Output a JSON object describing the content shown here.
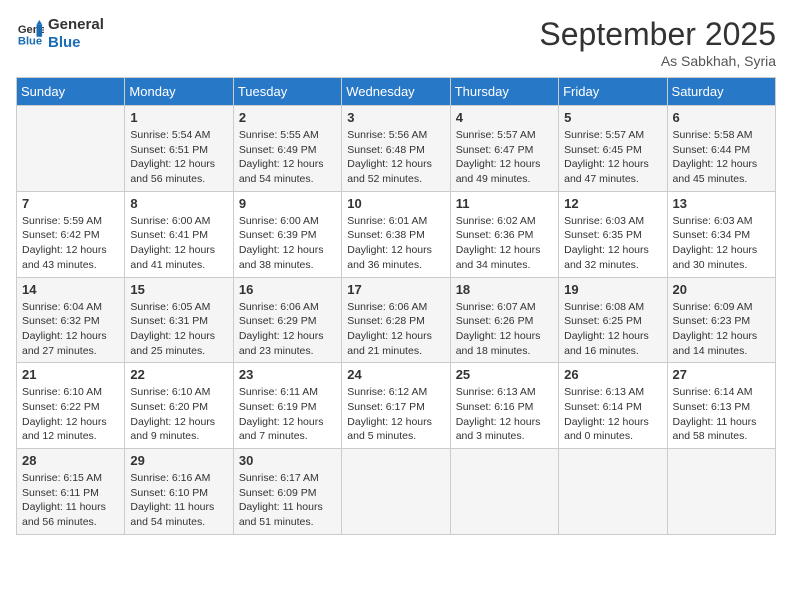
{
  "logo": {
    "line1": "General",
    "line2": "Blue"
  },
  "title": "September 2025",
  "location": "As Sabkhah, Syria",
  "days_header": [
    "Sunday",
    "Monday",
    "Tuesday",
    "Wednesday",
    "Thursday",
    "Friday",
    "Saturday"
  ],
  "weeks": [
    [
      {
        "day": "",
        "info": ""
      },
      {
        "day": "1",
        "info": "Sunrise: 5:54 AM\nSunset: 6:51 PM\nDaylight: 12 hours\nand 56 minutes."
      },
      {
        "day": "2",
        "info": "Sunrise: 5:55 AM\nSunset: 6:49 PM\nDaylight: 12 hours\nand 54 minutes."
      },
      {
        "day": "3",
        "info": "Sunrise: 5:56 AM\nSunset: 6:48 PM\nDaylight: 12 hours\nand 52 minutes."
      },
      {
        "day": "4",
        "info": "Sunrise: 5:57 AM\nSunset: 6:47 PM\nDaylight: 12 hours\nand 49 minutes."
      },
      {
        "day": "5",
        "info": "Sunrise: 5:57 AM\nSunset: 6:45 PM\nDaylight: 12 hours\nand 47 minutes."
      },
      {
        "day": "6",
        "info": "Sunrise: 5:58 AM\nSunset: 6:44 PM\nDaylight: 12 hours\nand 45 minutes."
      }
    ],
    [
      {
        "day": "7",
        "info": "Sunrise: 5:59 AM\nSunset: 6:42 PM\nDaylight: 12 hours\nand 43 minutes."
      },
      {
        "day": "8",
        "info": "Sunrise: 6:00 AM\nSunset: 6:41 PM\nDaylight: 12 hours\nand 41 minutes."
      },
      {
        "day": "9",
        "info": "Sunrise: 6:00 AM\nSunset: 6:39 PM\nDaylight: 12 hours\nand 38 minutes."
      },
      {
        "day": "10",
        "info": "Sunrise: 6:01 AM\nSunset: 6:38 PM\nDaylight: 12 hours\nand 36 minutes."
      },
      {
        "day": "11",
        "info": "Sunrise: 6:02 AM\nSunset: 6:36 PM\nDaylight: 12 hours\nand 34 minutes."
      },
      {
        "day": "12",
        "info": "Sunrise: 6:03 AM\nSunset: 6:35 PM\nDaylight: 12 hours\nand 32 minutes."
      },
      {
        "day": "13",
        "info": "Sunrise: 6:03 AM\nSunset: 6:34 PM\nDaylight: 12 hours\nand 30 minutes."
      }
    ],
    [
      {
        "day": "14",
        "info": "Sunrise: 6:04 AM\nSunset: 6:32 PM\nDaylight: 12 hours\nand 27 minutes."
      },
      {
        "day": "15",
        "info": "Sunrise: 6:05 AM\nSunset: 6:31 PM\nDaylight: 12 hours\nand 25 minutes."
      },
      {
        "day": "16",
        "info": "Sunrise: 6:06 AM\nSunset: 6:29 PM\nDaylight: 12 hours\nand 23 minutes."
      },
      {
        "day": "17",
        "info": "Sunrise: 6:06 AM\nSunset: 6:28 PM\nDaylight: 12 hours\nand 21 minutes."
      },
      {
        "day": "18",
        "info": "Sunrise: 6:07 AM\nSunset: 6:26 PM\nDaylight: 12 hours\nand 18 minutes."
      },
      {
        "day": "19",
        "info": "Sunrise: 6:08 AM\nSunset: 6:25 PM\nDaylight: 12 hours\nand 16 minutes."
      },
      {
        "day": "20",
        "info": "Sunrise: 6:09 AM\nSunset: 6:23 PM\nDaylight: 12 hours\nand 14 minutes."
      }
    ],
    [
      {
        "day": "21",
        "info": "Sunrise: 6:10 AM\nSunset: 6:22 PM\nDaylight: 12 hours\nand 12 minutes."
      },
      {
        "day": "22",
        "info": "Sunrise: 6:10 AM\nSunset: 6:20 PM\nDaylight: 12 hours\nand 9 minutes."
      },
      {
        "day": "23",
        "info": "Sunrise: 6:11 AM\nSunset: 6:19 PM\nDaylight: 12 hours\nand 7 minutes."
      },
      {
        "day": "24",
        "info": "Sunrise: 6:12 AM\nSunset: 6:17 PM\nDaylight: 12 hours\nand 5 minutes."
      },
      {
        "day": "25",
        "info": "Sunrise: 6:13 AM\nSunset: 6:16 PM\nDaylight: 12 hours\nand 3 minutes."
      },
      {
        "day": "26",
        "info": "Sunrise: 6:13 AM\nSunset: 6:14 PM\nDaylight: 12 hours\nand 0 minutes."
      },
      {
        "day": "27",
        "info": "Sunrise: 6:14 AM\nSunset: 6:13 PM\nDaylight: 11 hours\nand 58 minutes."
      }
    ],
    [
      {
        "day": "28",
        "info": "Sunrise: 6:15 AM\nSunset: 6:11 PM\nDaylight: 11 hours\nand 56 minutes."
      },
      {
        "day": "29",
        "info": "Sunrise: 6:16 AM\nSunset: 6:10 PM\nDaylight: 11 hours\nand 54 minutes."
      },
      {
        "day": "30",
        "info": "Sunrise: 6:17 AM\nSunset: 6:09 PM\nDaylight: 11 hours\nand 51 minutes."
      },
      {
        "day": "",
        "info": ""
      },
      {
        "day": "",
        "info": ""
      },
      {
        "day": "",
        "info": ""
      },
      {
        "day": "",
        "info": ""
      }
    ]
  ]
}
